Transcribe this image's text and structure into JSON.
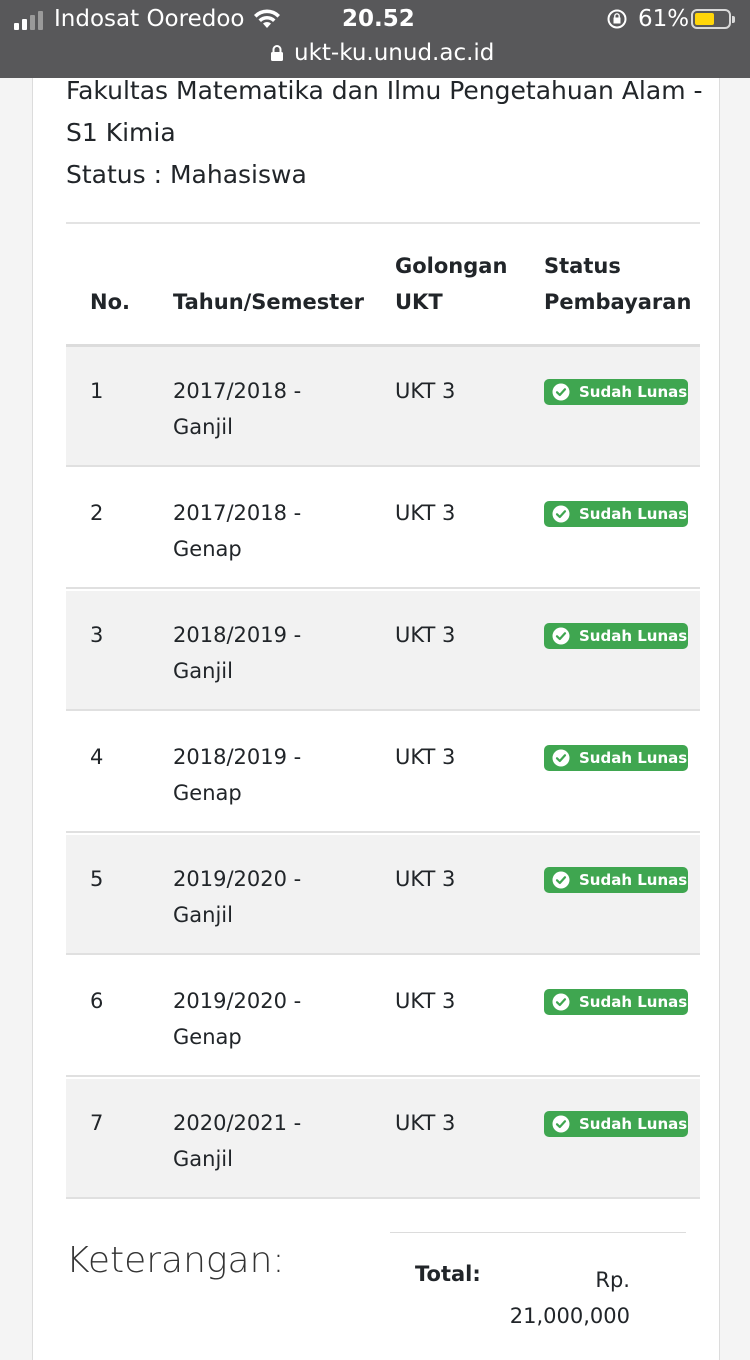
{
  "status_bar": {
    "carrier": "Indosat Ooredoo",
    "time": "20.52",
    "battery_percent": "61%",
    "battery_level": 0.61,
    "url": "ukt-ku.unud.ac.id",
    "icons": [
      "signal-icon",
      "wifi-icon",
      "rotation-lock-icon",
      "battery-icon",
      "lock-icon"
    ]
  },
  "student": {
    "faculty_line1": "Fakultas Matematika dan Ilmu Pengetahuan Alam -",
    "faculty_line2": "S1 Kimia",
    "status": "Status : Mahasiswa"
  },
  "table": {
    "headers": {
      "no": "No.",
      "tahun_semester": "Tahun/Semester",
      "golongan_line1": "Golongan",
      "golongan_line2": "UKT",
      "status_line1": "Status",
      "status_line2": "Pembayaran"
    },
    "rows": [
      {
        "no": "1",
        "year": "2017/2018 -",
        "semester": "Ganjil",
        "golongan": "UKT 3",
        "status": "Sudah Lunas"
      },
      {
        "no": "2",
        "year": "2017/2018 -",
        "semester": "Genap",
        "golongan": "UKT 3",
        "status": "Sudah Lunas"
      },
      {
        "no": "3",
        "year": "2018/2019 -",
        "semester": "Ganjil",
        "golongan": "UKT 3",
        "status": "Sudah Lunas"
      },
      {
        "no": "4",
        "year": "2018/2019 -",
        "semester": "Genap",
        "golongan": "UKT 3",
        "status": "Sudah Lunas"
      },
      {
        "no": "5",
        "year": "2019/2020 -",
        "semester": "Ganjil",
        "golongan": "UKT 3",
        "status": "Sudah Lunas"
      },
      {
        "no": "6",
        "year": "2019/2020 -",
        "semester": "Genap",
        "golongan": "UKT 3",
        "status": "Sudah Lunas"
      },
      {
        "no": "7",
        "year": "2020/2021 -",
        "semester": "Ganjil",
        "golongan": "UKT 3",
        "status": "Sudah Lunas"
      }
    ]
  },
  "footer": {
    "keterangan": "Keterangan:",
    "total_label": "Total:",
    "total_line1": "Rp.",
    "total_line2": "21,000,000"
  },
  "colors": {
    "badge_green": "#3fa650",
    "status_bar_bg": "#58585a",
    "stripe": "#f2f2f2"
  }
}
